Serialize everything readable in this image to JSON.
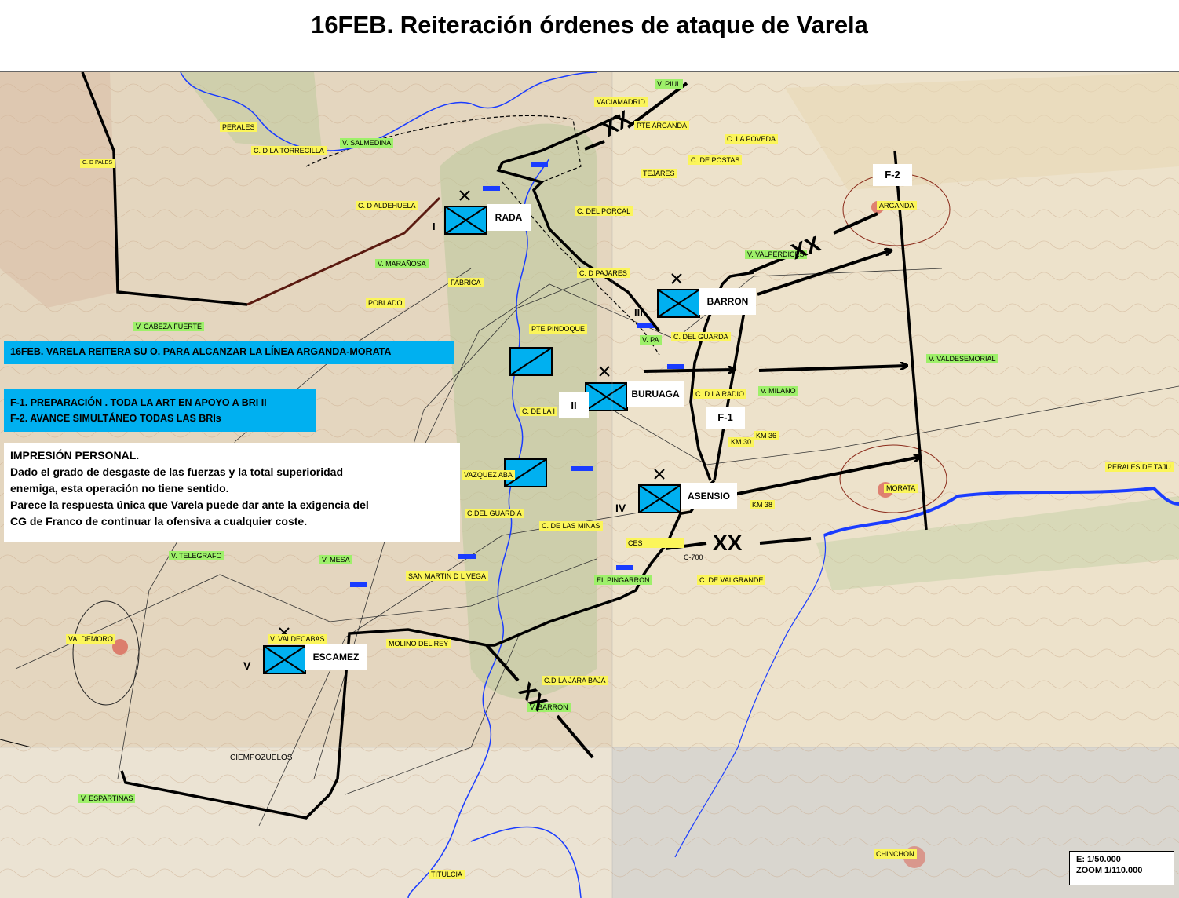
{
  "title": "16FEB. Reiteración órdenes de ataque de Varela",
  "banners": {
    "main": "16FEB. VARELA REITERA SU O. PARA ALCANZAR LA LÍNEA ARGANDA-MORATA",
    "phase_1": "F-1. PREPARACIÓN . TODA LA ART EN APOYO A BRI II",
    "phase_2": "F-2. AVANCE SIMULTÁNEO TODAS LAS BRIs"
  },
  "note": {
    "heading": "IMPRESIÓN PERSONAL.",
    "line_1": "Dado el grado de desgaste de las fuerzas y la total superioridad",
    "line_2": "enemiga, esta operación no tiene sentido.",
    "line_3": "Parece la respuesta única que Varela puede dar ante la exigencia del",
    "line_4": "CG de  Franco de continuar la ofensiva  a cualquier coste."
  },
  "units": {
    "rada": "RADA",
    "rada_roman": "I",
    "barron": "BARRON",
    "barron_roman": "III",
    "buruaga": "BURUAGA",
    "buruaga_roman": "II",
    "asensio": "ASENSIO",
    "asensio_roman": "IV",
    "escamez": "ESCAMEZ",
    "escamez_roman": "V"
  },
  "phases": {
    "f1": "F-1",
    "f2": "F-2"
  },
  "boundary_marks": {
    "xx": "XX"
  },
  "scale": {
    "line_1": "E: 1/50.000",
    "line_2": "ZOOM 1/110.000"
  },
  "colors": {
    "friendly_unit": "#00b0f0",
    "banner": "#00b0f0",
    "river": "#1a3cff",
    "yellow_label": "#fbf55a",
    "green_label": "#9ef06a"
  },
  "places": {
    "v_piul": "V. PIUL",
    "vaciamadrid": "VACIAMADRID",
    "ptearganda": "PTE ARGANDA",
    "perales": "PERALES",
    "c_torrecilla": "C. D LA TORRECILLA",
    "v_salmedina": "V. SALMEDINA",
    "c_la_poveda": "C. LA POVEDA",
    "c_de_postas": "C. DE POSTAS",
    "tejares": "TEJARES",
    "c_aldehuela": "C. D ALDEHUELA",
    "c_del_porcal": "C. DEL PORCAL",
    "arganda": "ARGANDA",
    "v_valperdices": "V. VALPERDICES",
    "v_maranosa": "V. MARAÑOSA",
    "c_d_pajares": "C. D PAJARES",
    "fabrica": "FABRICA",
    "poblado": "POBLADO",
    "v_cabeza_fuerte": "V. CABEZA FUERTE",
    "pte_pindoque": "PTE PINDOQUE",
    "c_del_guarda": "C. DEL GUARDA",
    "v_pa": "V. PA",
    "c_d_la_radio": "C. D LA RADIO",
    "v_milano": "V. MILANO",
    "v_valdesemorial": "V. VALDESEMORIAL",
    "c_de_la_i": "C. DE LA I",
    "km36": "KM 36",
    "km30": "KM 30",
    "km38": "KM 38",
    "vazquez": "VAZQUEZ ABA",
    "perales_tajuna": "PERALES DE TAJU",
    "morata": "MORATA",
    "c_del_guardia": "C.DEL GUARDIA",
    "c_de_las_minas": "C. DE LAS MINAS",
    "ces": "CES",
    "c700": "C-700",
    "v_telegrafo": "V. TELEGRAFO",
    "v_mesa": "V. MESA",
    "san_martin": "SAN MARTIN D L VEGA",
    "el_pingarron": "EL PINGARRON",
    "c_valgrande": "C. DE VALGRANDE",
    "valdemoro": "VALDEMORO",
    "v_valdecabas": "V. VALDECABAS",
    "molino_del_rey": "MOLINO DEL REY",
    "c_jara_baja": "C.D LA JARA BAJA",
    "v_barron": "V. BARRON",
    "ciempozuelos": "CIEMPOZUELOS",
    "v_espartinas": "V. ESPARTINAS",
    "chinchon": "CHINCHON",
    "titulcia": "TITULCIA",
    "c_d_pales": "C. D PALES"
  }
}
